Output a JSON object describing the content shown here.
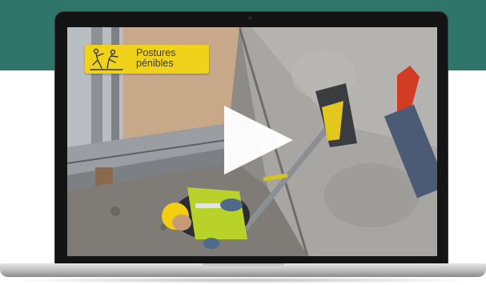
{
  "video": {
    "badge": {
      "line1": "Postures",
      "line2": "pénibles",
      "icon": "worker-posture-icon"
    },
    "play_icon": "play-icon"
  },
  "colors": {
    "header_band": "#2f7569",
    "badge_background": "#f1d21b",
    "badge_text": "#3a3a3a"
  }
}
